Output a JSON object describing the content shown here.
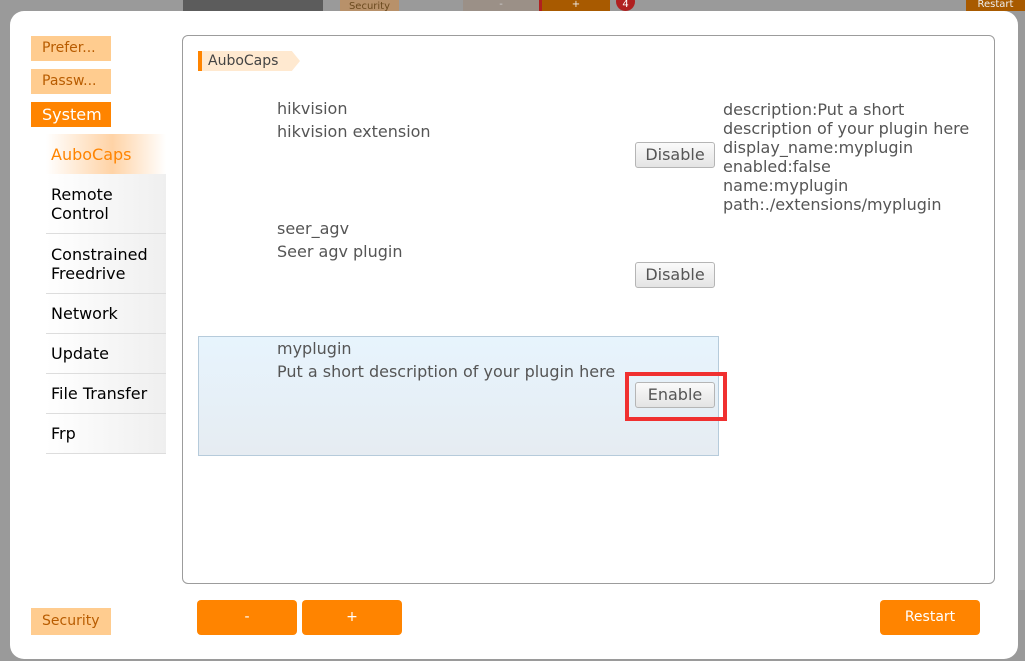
{
  "background": {
    "security_tab": "Security",
    "minus": "-",
    "plus": "+",
    "badge_count": "4",
    "restart": "Restart"
  },
  "sidebar": {
    "categories": [
      {
        "label": "Prefer..."
      },
      {
        "label": "Passw..."
      },
      {
        "label": "System"
      }
    ],
    "items": [
      {
        "label": "AuboCaps"
      },
      {
        "label": "Remote Control"
      },
      {
        "label": "Constrained Freedrive"
      },
      {
        "label": "Network"
      },
      {
        "label": "Update"
      },
      {
        "label": "File Transfer"
      },
      {
        "label": "Frp"
      }
    ],
    "security": "Security"
  },
  "main": {
    "section_tag": "AuboCaps",
    "plugins": [
      {
        "name": "hikvision",
        "description": "hikvision extension",
        "button": "Disable"
      },
      {
        "name": "seer_agv",
        "description": "Seer agv plugin",
        "button": "Disable"
      },
      {
        "name": "myplugin",
        "description": "Put a short description of your plugin here",
        "button": "Enable"
      }
    ],
    "details": [
      "description:Put a short",
      "description of your plugin here",
      "display_name:myplugin",
      "enabled:false",
      "name:myplugin",
      "path:./extensions/myplugin"
    ]
  },
  "footer": {
    "minus": "-",
    "plus": "+",
    "restart": "Restart"
  },
  "colors": {
    "accent": "#ff8400",
    "highlight_box": "#f03030"
  }
}
